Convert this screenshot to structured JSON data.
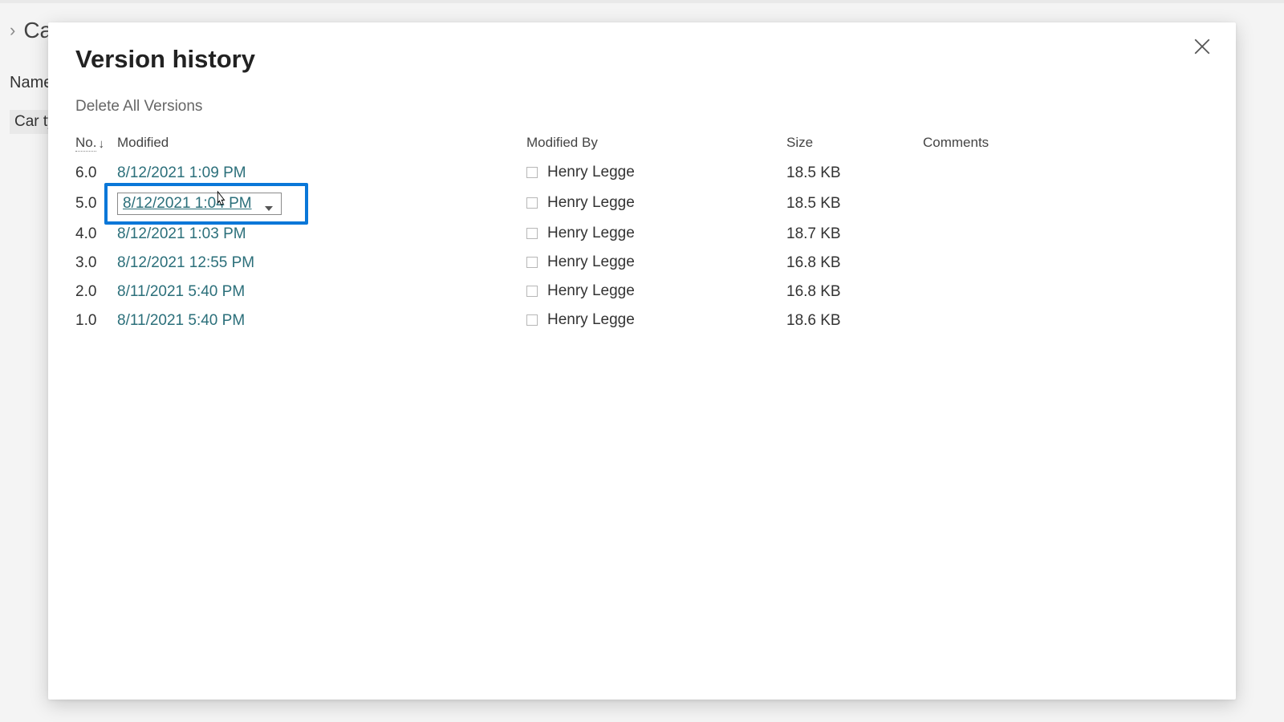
{
  "bg": {
    "breadcrumb": "Ca",
    "nameHeader": "Name",
    "fileName": "Car typ"
  },
  "panel": {
    "title": "Version history",
    "deleteAll": "Delete All Versions"
  },
  "columns": {
    "no": "No.",
    "modified": "Modified",
    "modifiedBy": "Modified By",
    "size": "Size",
    "comments": "Comments"
  },
  "highlightIndex": 1,
  "rows": [
    {
      "no": "6.0",
      "modified": "8/12/2021 1:09 PM",
      "by": "Henry Legge",
      "size": "18.5 KB",
      "comments": ""
    },
    {
      "no": "5.0",
      "modified": "8/12/2021 1:04 PM",
      "by": "Henry Legge",
      "size": "18.5 KB",
      "comments": ""
    },
    {
      "no": "4.0",
      "modified": "8/12/2021 1:03 PM",
      "by": "Henry Legge",
      "size": "18.7 KB",
      "comments": ""
    },
    {
      "no": "3.0",
      "modified": "8/12/2021 12:55 PM",
      "by": "Henry Legge",
      "size": "16.8 KB",
      "comments": ""
    },
    {
      "no": "2.0",
      "modified": "8/11/2021 5:40 PM",
      "by": "Henry Legge",
      "size": "16.8 KB",
      "comments": ""
    },
    {
      "no": "1.0",
      "modified": "8/11/2021 5:40 PM",
      "by": "Henry Legge",
      "size": "18.6 KB",
      "comments": ""
    }
  ]
}
